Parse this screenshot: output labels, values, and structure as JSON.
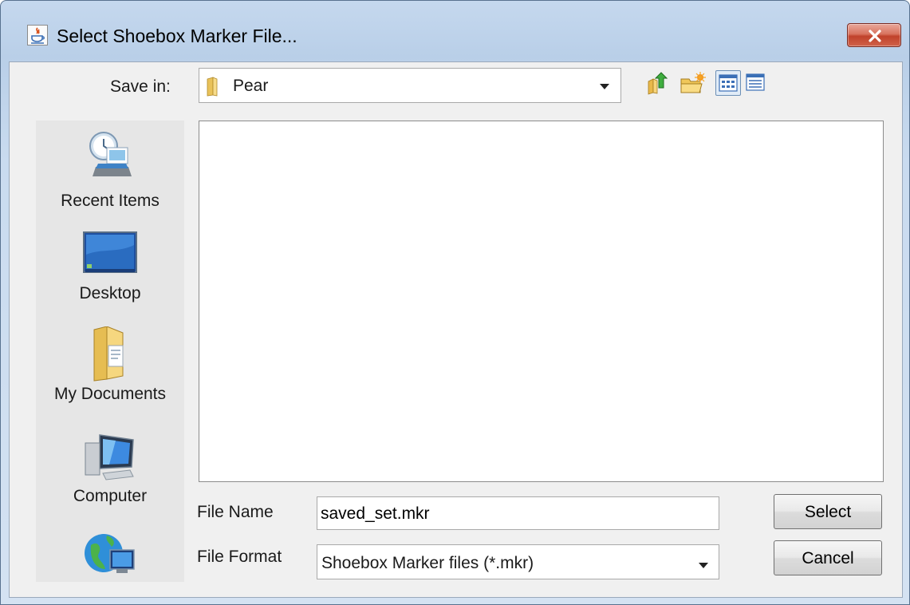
{
  "window": {
    "title": "Select Shoebox Marker File..."
  },
  "save_in": {
    "label": "Save in:",
    "value": "Pear"
  },
  "toolbar": {
    "icons": [
      "up-one-level-icon",
      "create-new-folder-icon",
      "list-view-icon",
      "details-view-icon"
    ],
    "active_view": "list-view"
  },
  "places": [
    {
      "label": "Recent Items",
      "icon": "recent-items-icon"
    },
    {
      "label": "Desktop",
      "icon": "desktop-icon"
    },
    {
      "label": "My Documents",
      "icon": "my-documents-icon"
    },
    {
      "label": "Computer",
      "icon": "computer-icon"
    },
    {
      "label": "",
      "icon": "network-icon"
    }
  ],
  "file_name": {
    "label": "File Name",
    "value": "saved_set.mkr"
  },
  "file_format": {
    "label": "File Format",
    "value": "Shoebox Marker files (*.mkr)"
  },
  "buttons": {
    "select": "Select",
    "cancel": "Cancel"
  },
  "colors": {
    "title_bar": "#b9cfe8",
    "close_button": "#c0422b",
    "dialog_bg": "#f0f0f0"
  }
}
